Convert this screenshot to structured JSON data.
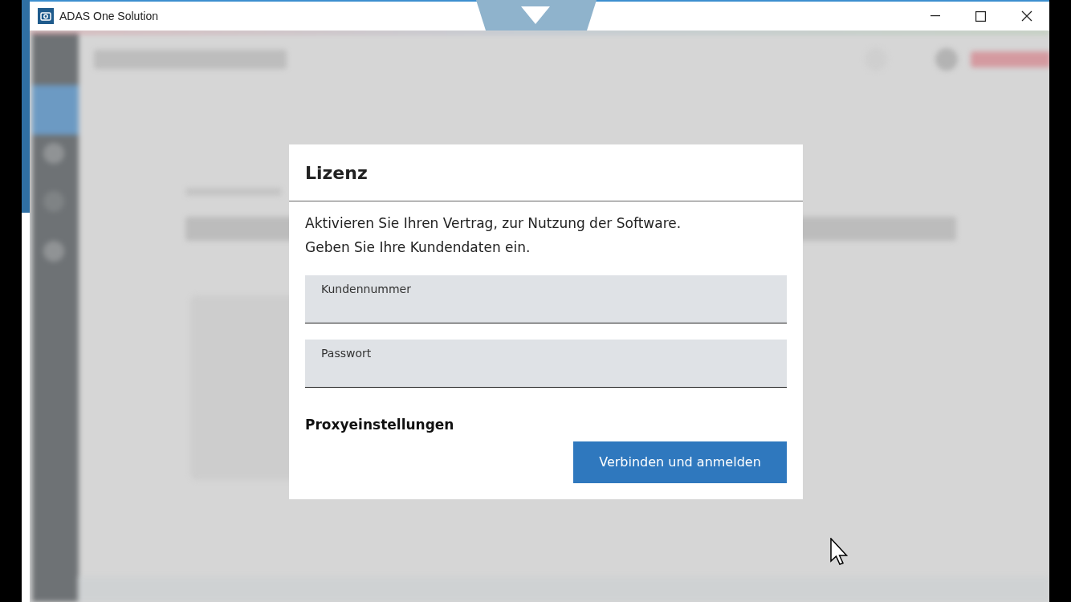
{
  "window": {
    "title": "ADAS One Solution"
  },
  "dialog": {
    "title": "Lizenz",
    "lines": [
      "Aktivieren Sie Ihren Vertrag, zur Nutzung der Software.",
      "Geben Sie Ihre Kundendaten ein."
    ],
    "fields": [
      {
        "label": "Kundennummer"
      },
      {
        "label": "Passwort"
      }
    ],
    "proxy_link": "Proxyeinstellungen",
    "button": "Verbinden und anmelden"
  }
}
